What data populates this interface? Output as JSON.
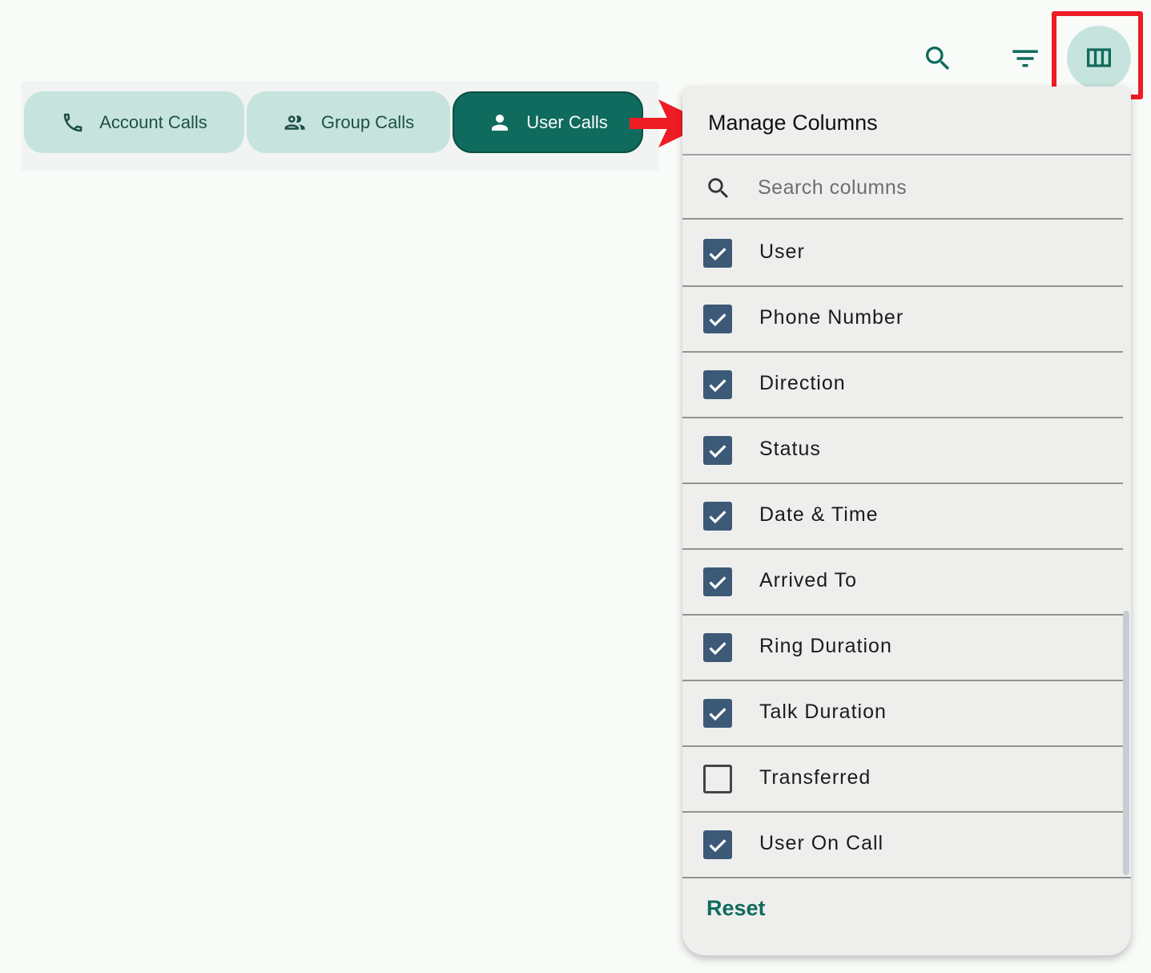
{
  "toolbar": {
    "search_icon": "search-icon",
    "filter_icon": "filter-icon",
    "columns_icon": "view-columns-icon"
  },
  "tabs": [
    {
      "label": "Account Calls",
      "icon": "phone-icon"
    },
    {
      "label": "Group Calls",
      "icon": "group-icon"
    },
    {
      "label": "User Calls",
      "icon": "person-icon",
      "active": true
    }
  ],
  "panel": {
    "title": "Manage Columns",
    "search_placeholder": "Search columns",
    "columns": [
      {
        "label": "User",
        "checked": true
      },
      {
        "label": "Phone Number",
        "checked": true
      },
      {
        "label": "Direction",
        "checked": true
      },
      {
        "label": "Status",
        "checked": true
      },
      {
        "label": "Date & Time",
        "checked": true
      },
      {
        "label": "Arrived To",
        "checked": true
      },
      {
        "label": "Ring Duration",
        "checked": true
      },
      {
        "label": "Talk Duration",
        "checked": true
      },
      {
        "label": "Transferred",
        "checked": false
      },
      {
        "label": "User On Call",
        "checked": true
      }
    ],
    "reset_label": "Reset"
  },
  "colors": {
    "accent": "#0f6b5d",
    "tab_bg": "#c6e4dd",
    "checkbox": "#3c5a78",
    "highlight": "#ee1c24"
  }
}
